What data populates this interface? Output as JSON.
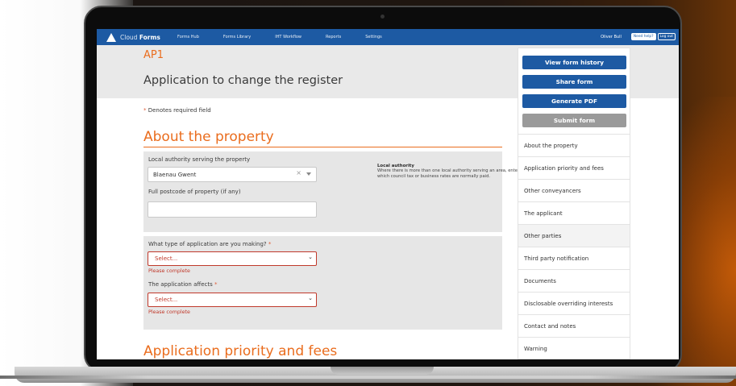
{
  "app": {
    "brand_light": "Cloud",
    "brand_bold": "Forms",
    "nav": [
      "Forms Hub",
      "Forms Library",
      "IHT Workflow",
      "Reports",
      "Settings"
    ],
    "user_name": "Oliver Bull",
    "help_label": "Need help?",
    "logout_label": "Log out"
  },
  "colors": {
    "brand_blue": "#1d5aa3",
    "accent_orange": "#ea6d1e",
    "error_red": "#c0392b",
    "disabled_gray": "#9a9a9a"
  },
  "header": {
    "form_code": "AP1",
    "form_title": "Application to change the register"
  },
  "required_note": {
    "star": "*",
    "text": "Denotes required field"
  },
  "sections": {
    "property_heading": "About the property",
    "priority_heading": "Application priority and fees"
  },
  "property": {
    "authority_label": "Local authority serving the property",
    "authority_value": "Blaenau Gwent",
    "clear_glyph": "×",
    "postcode_label": "Full postcode of property (if any)",
    "postcode_value": "",
    "help_title": "Local authority",
    "help_text": "Where there is more than one local authority serving an area, enter the one to which council tax or business rates are normally paid."
  },
  "application": {
    "type_label": "What type of application are you making?",
    "type_required": "*",
    "type_selected": "Select...",
    "type_error": "Please complete",
    "affects_label": "The application affects",
    "affects_required": "*",
    "affects_selected": "Select...",
    "affects_error": "Please complete"
  },
  "sidebar": {
    "buttons": [
      {
        "label": "View form history",
        "state": "active"
      },
      {
        "label": "Share form",
        "state": "active"
      },
      {
        "label": "Generate PDF",
        "state": "active"
      },
      {
        "label": "Submit form",
        "state": "disabled"
      }
    ],
    "items": [
      "About the property",
      "Application priority and fees",
      "Other conveyancers",
      "The applicant",
      "Other parties",
      "Third party notification",
      "Documents",
      "Disclosable overriding interests",
      "Contact and notes",
      "Warning"
    ]
  }
}
